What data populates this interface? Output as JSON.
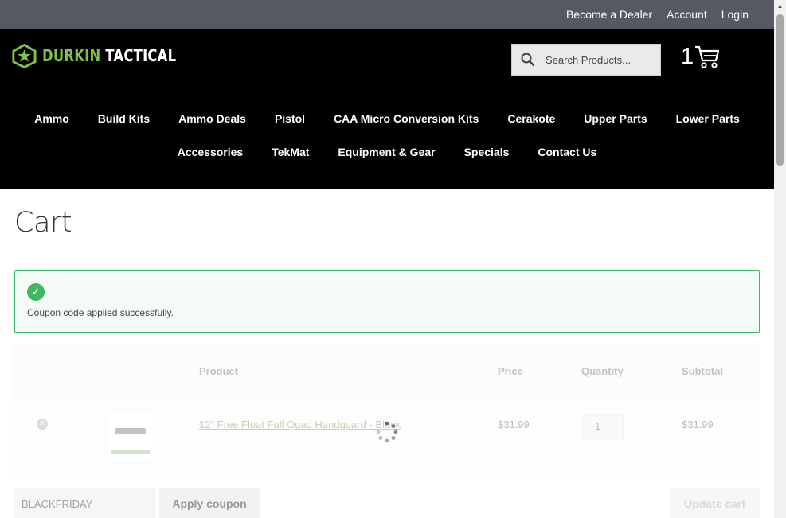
{
  "topbar": {
    "links": [
      "Become a Dealer",
      "Account",
      "Login"
    ]
  },
  "header": {
    "logo_part1": "DURKIN",
    "logo_part2": "TACTICAL",
    "search_placeholder": "Search Products...",
    "cart_count": "1",
    "nav_row1": [
      "Ammo",
      "Build Kits",
      "Ammo Deals",
      "Pistol",
      "CAA Micro Conversion Kits",
      "Cerakote",
      "Upper Parts",
      "Lower Parts"
    ],
    "nav_row2": [
      "Accessories",
      "TekMat",
      "Equipment & Gear",
      "Specials",
      "Contact Us"
    ]
  },
  "main": {
    "title": "Cart",
    "notice": "Coupon code applied successfully.",
    "table": {
      "headers": [
        "Product",
        "Price",
        "Quantity",
        "Subtotal"
      ],
      "rows": [
        {
          "product": "12\" Free Float Full Quad Handguard - Black",
          "price": "$31.99",
          "quantity": "1",
          "subtotal": "$31.99"
        }
      ]
    },
    "coupon_value": "BLACKFRIDAY",
    "apply_label": "Apply coupon",
    "update_label": "Update cart"
  },
  "colors": {
    "accent": "#7fc241",
    "success": "#3eb862",
    "topbar": "#555a62",
    "header": "#000000"
  },
  "icons": [
    "logo-star-icon",
    "search-icon",
    "cart-icon",
    "check-icon",
    "remove-icon",
    "spinner-icon"
  ]
}
